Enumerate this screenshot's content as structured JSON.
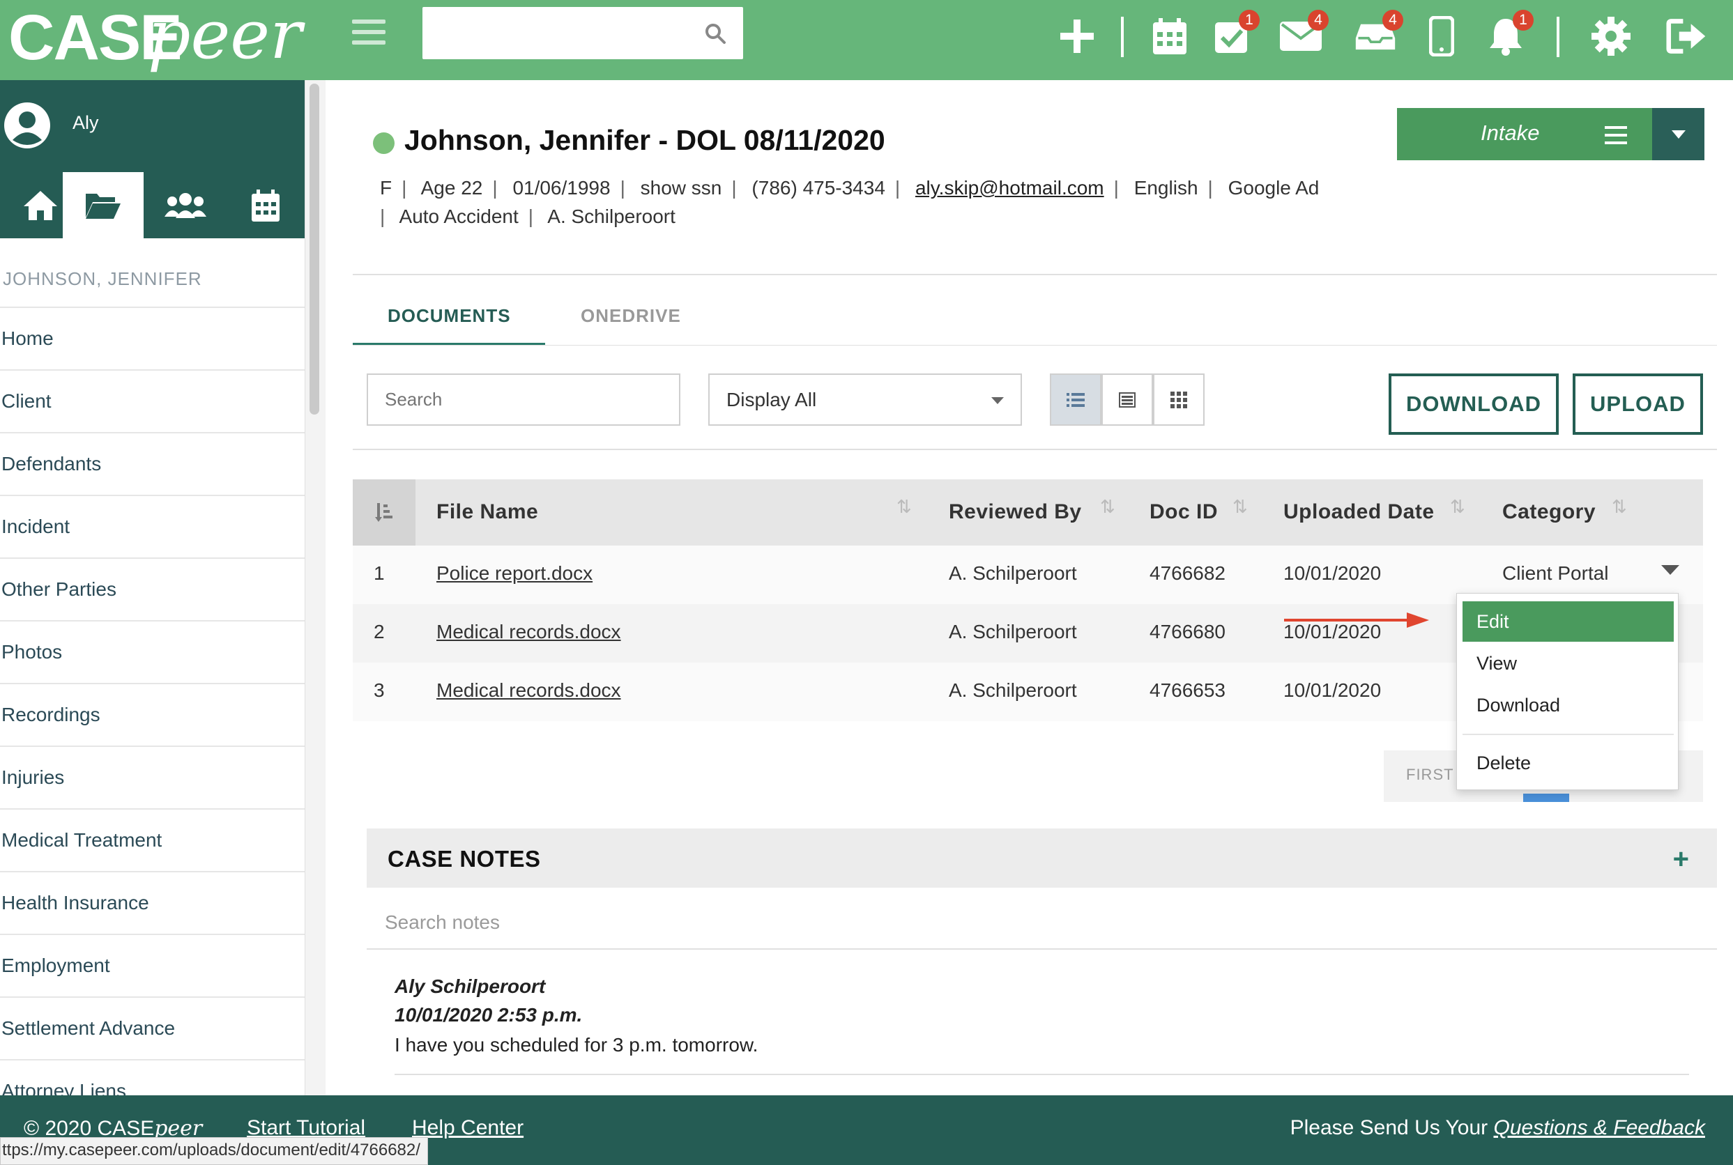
{
  "topbar": {
    "logo_case": "CASE",
    "logo_peer": "peer",
    "search_placeholder": "",
    "badges": {
      "tasks": "1",
      "mail": "4",
      "inbox": "4",
      "notifications": "1"
    }
  },
  "sidebar": {
    "user_name": "Aly",
    "case_label": "JOHNSON, JENNIFER",
    "items": [
      "Home",
      "Client",
      "Defendants",
      "Incident",
      "Other Parties",
      "Photos",
      "Recordings",
      "Injuries",
      "Medical Treatment",
      "Health Insurance",
      "Employment",
      "Settlement Advance",
      "Attorney Liens"
    ]
  },
  "header": {
    "title": "Johnson, Jennifer - DOL 08/11/2020",
    "meta1": [
      "F",
      "Age 22",
      "01/06/1998",
      "show ssn",
      "(786) 475-3434"
    ],
    "email": "aly.skip@hotmail.com",
    "meta1_tail": [
      "English",
      "Google Ad"
    ],
    "meta2": [
      "Auto Accident",
      "A. Schilperoort"
    ],
    "intake_label": "Intake"
  },
  "tabs": {
    "documents": "DOCUMENTS",
    "onedrive": "ONEDRIVE"
  },
  "toolbar": {
    "search_placeholder": "Search",
    "display_value": "Display All",
    "download_label": "DOWNLOAD",
    "upload_label": "UPLOAD"
  },
  "table": {
    "headers": {
      "file_name": "File Name",
      "reviewed_by": "Reviewed By",
      "doc_id": "Doc ID",
      "uploaded_date": "Uploaded Date",
      "category": "Category"
    },
    "rows": [
      {
        "num": "1",
        "file": "Police report.docx",
        "reviewed": "A. Schilperoort",
        "doc_id": "4766682",
        "date": "10/01/2020",
        "category": "Client Portal"
      },
      {
        "num": "2",
        "file": "Medical records.docx",
        "reviewed": "A. Schilperoort",
        "doc_id": "4766680",
        "date": "10/01/2020",
        "category": ""
      },
      {
        "num": "3",
        "file": "Medical records.docx",
        "reviewed": "A. Schilperoort",
        "doc_id": "4766653",
        "date": "10/01/2020",
        "category": ""
      }
    ]
  },
  "context_menu": {
    "edit": "Edit",
    "view": "View",
    "download": "Download",
    "delete": "Delete"
  },
  "pagination": {
    "first": "FIRST"
  },
  "notes": {
    "title": "CASE NOTES",
    "search_placeholder": "Search notes",
    "author": "Aly Schilperoort",
    "date": "10/01/2020 2:53 p.m.",
    "text": "I have you scheduled for 3 p.m. tomorrow."
  },
  "footer": {
    "copyright_prefix": "© 2020 CASE",
    "copyright_peer": "peer",
    "tutorial": "Start Tutorial",
    "help": "Help Center",
    "feedback_prefix": "Please Send Us Your ",
    "feedback_link": "Questions & Feedback"
  },
  "status_url": "ttps://my.casepeer.com/uploads/document/edit/4766682/",
  "colors": {
    "topbar": "#66b67a",
    "sidebar_dark": "#255c54",
    "accent_green": "#4a9a5d",
    "badge_red": "#d9442e"
  }
}
